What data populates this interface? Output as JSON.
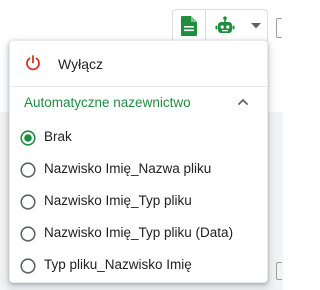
{
  "toolbar": {
    "doc_icon": "document-icon",
    "robot_icon": "robot-icon",
    "caret_icon": "caret-down-icon",
    "accent_color": "#1e8e3e"
  },
  "menu": {
    "power": {
      "label": "Wyłącz",
      "icon": "power-icon",
      "icon_color": "#d93025"
    },
    "section": {
      "title": "Automatyczne nazewnictwo",
      "color": "#1e8e3e",
      "chevron": "chevron-up-icon",
      "expanded": true
    },
    "options": [
      {
        "label": "Brak",
        "selected": true
      },
      {
        "label": "Nazwisko Imię_Nazwa pliku",
        "selected": false
      },
      {
        "label": "Nazwisko Imię_Typ pliku",
        "selected": false
      },
      {
        "label": "Nazwisko Imię_Typ pliku (Data)",
        "selected": false
      },
      {
        "label": "Typ pliku_Nazwisko Imię",
        "selected": false
      }
    ]
  }
}
